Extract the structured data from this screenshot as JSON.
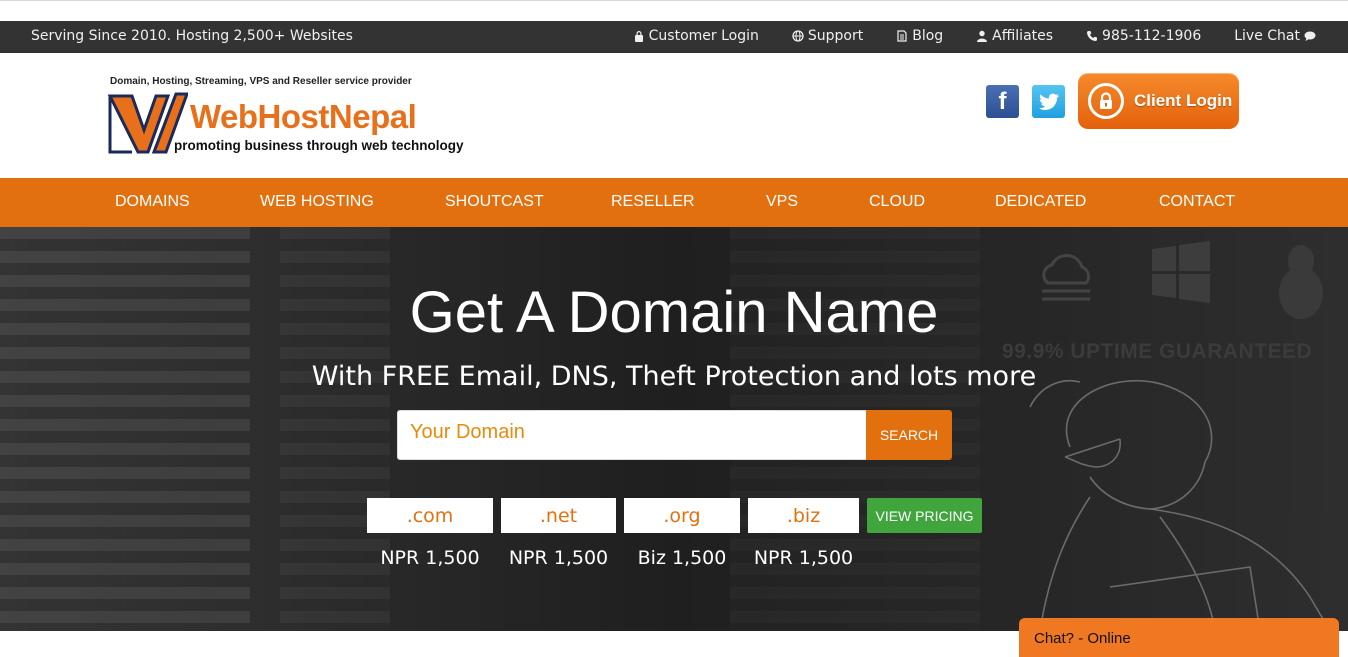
{
  "topbar": {
    "tagline": "Serving Since 2010. Hosting 2,500+ Websites",
    "links": [
      {
        "label": "Customer Login",
        "icon": "lock-icon"
      },
      {
        "label": "Support",
        "icon": "globe-icon"
      },
      {
        "label": "Blog",
        "icon": "document-icon"
      },
      {
        "label": "Affiliates",
        "icon": "user-icon"
      },
      {
        "label": "985-112-1906",
        "icon": "phone-icon"
      },
      {
        "label": "Live Chat",
        "icon": "chat-bubble-icon"
      }
    ]
  },
  "header": {
    "logo_tagline": "Domain, Hosting, Streaming, VPS and Reseller service provider",
    "logo_name": "WebHostNepal",
    "logo_slogan": "promoting business through web technology",
    "facebook_glyph": "f",
    "client_login_label": "Client Login"
  },
  "nav": {
    "items": [
      "DOMAINS",
      "WEB HOSTING",
      "SHOUTCAST",
      "RESELLER",
      "VPS",
      "CLOUD",
      "DEDICATED",
      "CONTACT"
    ]
  },
  "hero": {
    "title": "Get A Domain Name",
    "subtitle": "With FREE Email, DNS, Theft Protection and lots more",
    "uptime": "99.9% UPTIME GUARANTEED",
    "search_value": "Your Domain",
    "search_button": "SEARCH",
    "tlds": [
      {
        "ext": ".com",
        "price": "NPR 1,500"
      },
      {
        "ext": ".net",
        "price": "NPR 1,500"
      },
      {
        "ext": ".org",
        "price": "Biz 1,500"
      },
      {
        "ext": ".biz",
        "price": "NPR 1,500"
      }
    ],
    "view_pricing": "VIEW PRICING"
  },
  "chat": {
    "label": "Chat? - Online"
  },
  "colors": {
    "brand_orange": "#e3700e",
    "topbar_bg": "#333333",
    "view_pricing_green": "#3fa53c"
  }
}
